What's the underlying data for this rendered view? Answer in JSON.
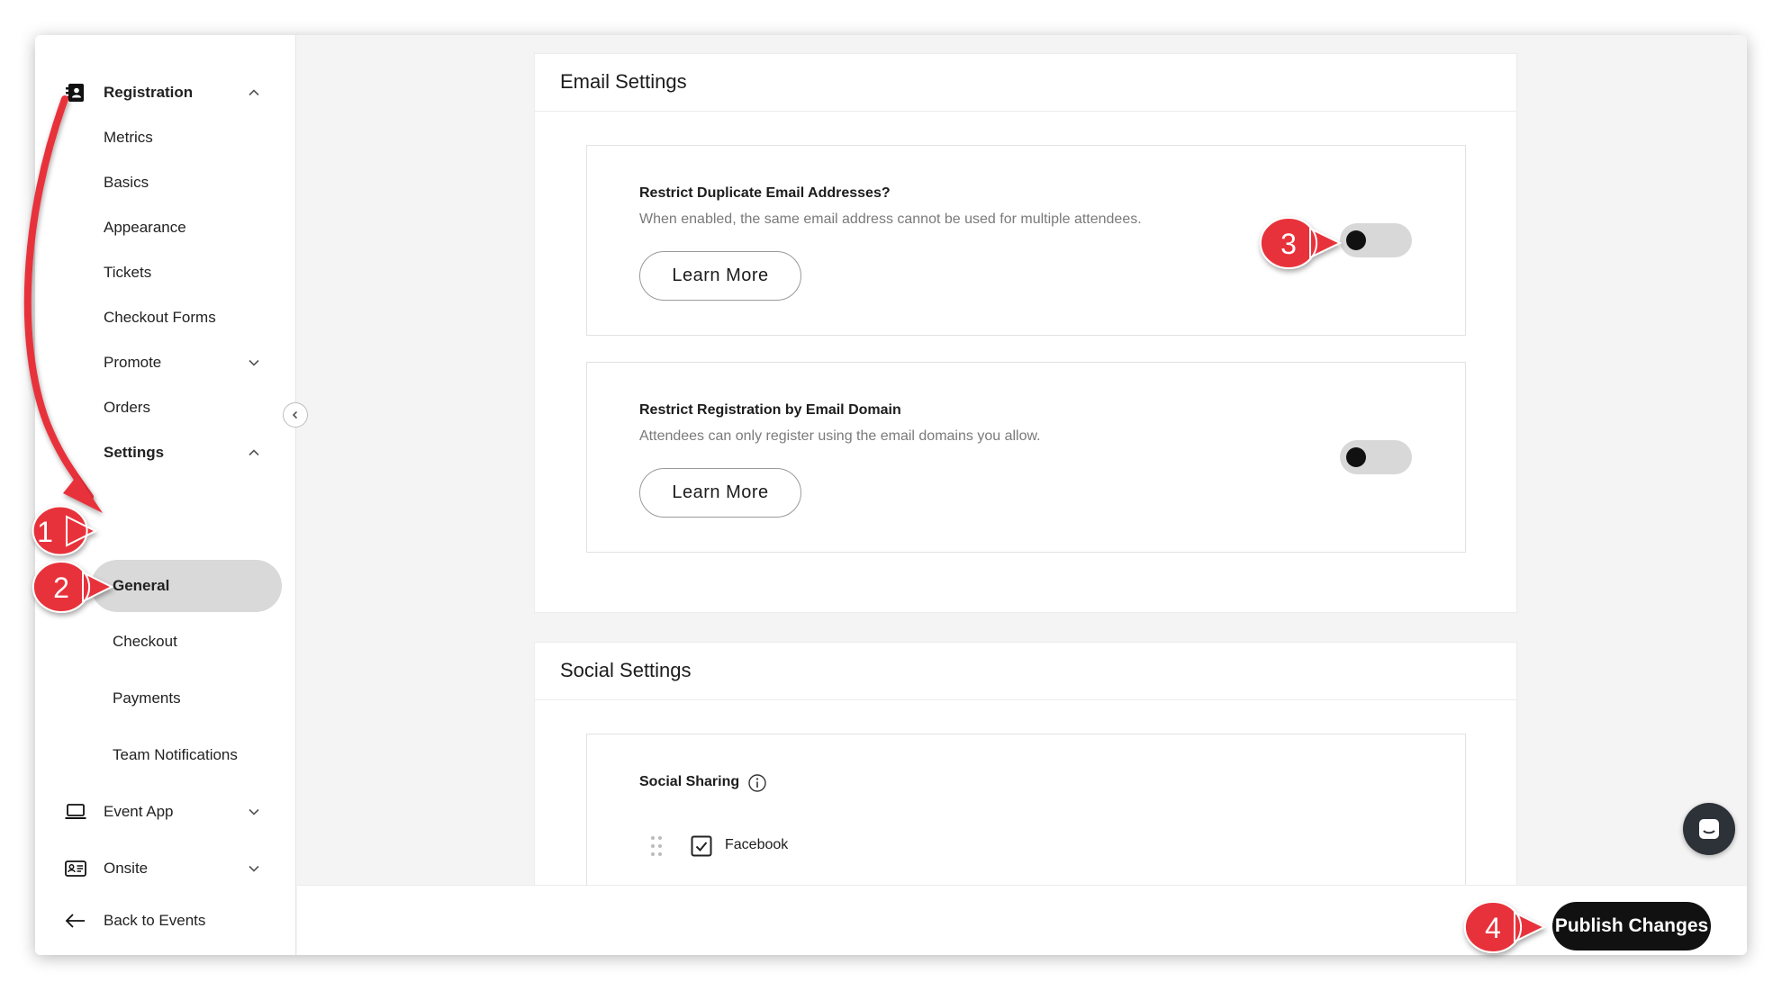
{
  "sidebar": {
    "registration": {
      "label": "Registration",
      "icon": "address-book-icon"
    },
    "items": [
      {
        "label": "Metrics"
      },
      {
        "label": "Basics"
      },
      {
        "label": "Appearance"
      },
      {
        "label": "Tickets"
      },
      {
        "label": "Checkout Forms"
      },
      {
        "label": "Promote"
      },
      {
        "label": "Orders"
      },
      {
        "label": "Settings"
      }
    ],
    "settings_sub": [
      {
        "label": "General",
        "active": true
      },
      {
        "label": "Checkout"
      },
      {
        "label": "Payments"
      },
      {
        "label": "Team Notifications"
      }
    ],
    "event_app": {
      "label": "Event App",
      "icon": "laptop-icon"
    },
    "onsite": {
      "label": "Onsite",
      "icon": "id-card-icon"
    },
    "back": {
      "label": "Back to Events",
      "icon": "arrow-left-icon"
    }
  },
  "email_settings": {
    "title": "Email Settings",
    "options": [
      {
        "title": "Restrict Duplicate Email Addresses?",
        "description": "When enabled, the same email address cannot be used for multiple attendees.",
        "button": "Learn More",
        "enabled": false
      },
      {
        "title": "Restrict Registration by Email Domain",
        "description": "Attendees can only register using the email domains you allow.",
        "button": "Learn More",
        "enabled": false
      }
    ]
  },
  "social_settings": {
    "title": "Social Settings",
    "sharing_label": "Social Sharing",
    "networks": [
      {
        "label": "Facebook",
        "checked": true
      }
    ]
  },
  "footer": {
    "publish_label": "Publish Changes"
  },
  "annotations": {
    "color": "#e8333b",
    "steps": [
      "1",
      "2",
      "3",
      "4"
    ]
  }
}
